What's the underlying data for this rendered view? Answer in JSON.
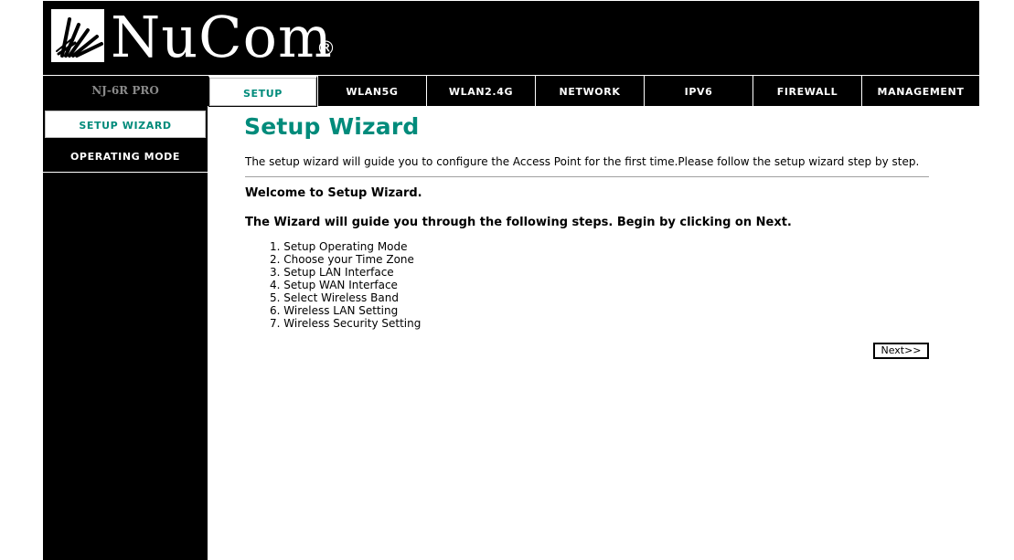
{
  "header": {
    "logo_text": "NuCom",
    "registered_mark": "®",
    "logo_icon": "antenna-logo-icon"
  },
  "nav": {
    "model": "NJ-6R PRO",
    "tabs": [
      {
        "label": "SETUP",
        "active": true
      },
      {
        "label": "WLAN5G",
        "active": false
      },
      {
        "label": "WLAN2.4G",
        "active": false
      },
      {
        "label": "NETWORK",
        "active": false
      },
      {
        "label": "IPV6",
        "active": false
      },
      {
        "label": "FIREWALL",
        "active": false
      },
      {
        "label": "MANAGEMENT",
        "active": false
      }
    ]
  },
  "sidebar": {
    "items": [
      {
        "label": "SETUP WIZARD",
        "active": true
      },
      {
        "label": "OPERATING MODE",
        "active": false
      }
    ]
  },
  "main": {
    "title": "Setup Wizard",
    "intro": "The setup wizard will guide you to configure the Access Point for the first time.Please follow the setup wizard step by step.",
    "welcome": "Welcome to Setup Wizard.",
    "guide": "The Wizard will guide you through the following steps. Begin by clicking on Next.",
    "steps": [
      "1. Setup Operating Mode",
      "2. Choose your Time Zone",
      "3. Setup LAN Interface",
      "4. Setup WAN Interface",
      "5. Select Wireless Band",
      "6. Wireless LAN Setting",
      "7. Wireless Security Setting"
    ],
    "next_label": "Next>>"
  },
  "colors": {
    "accent": "#008b7b",
    "background": "#000000",
    "page": "#ffffff"
  }
}
